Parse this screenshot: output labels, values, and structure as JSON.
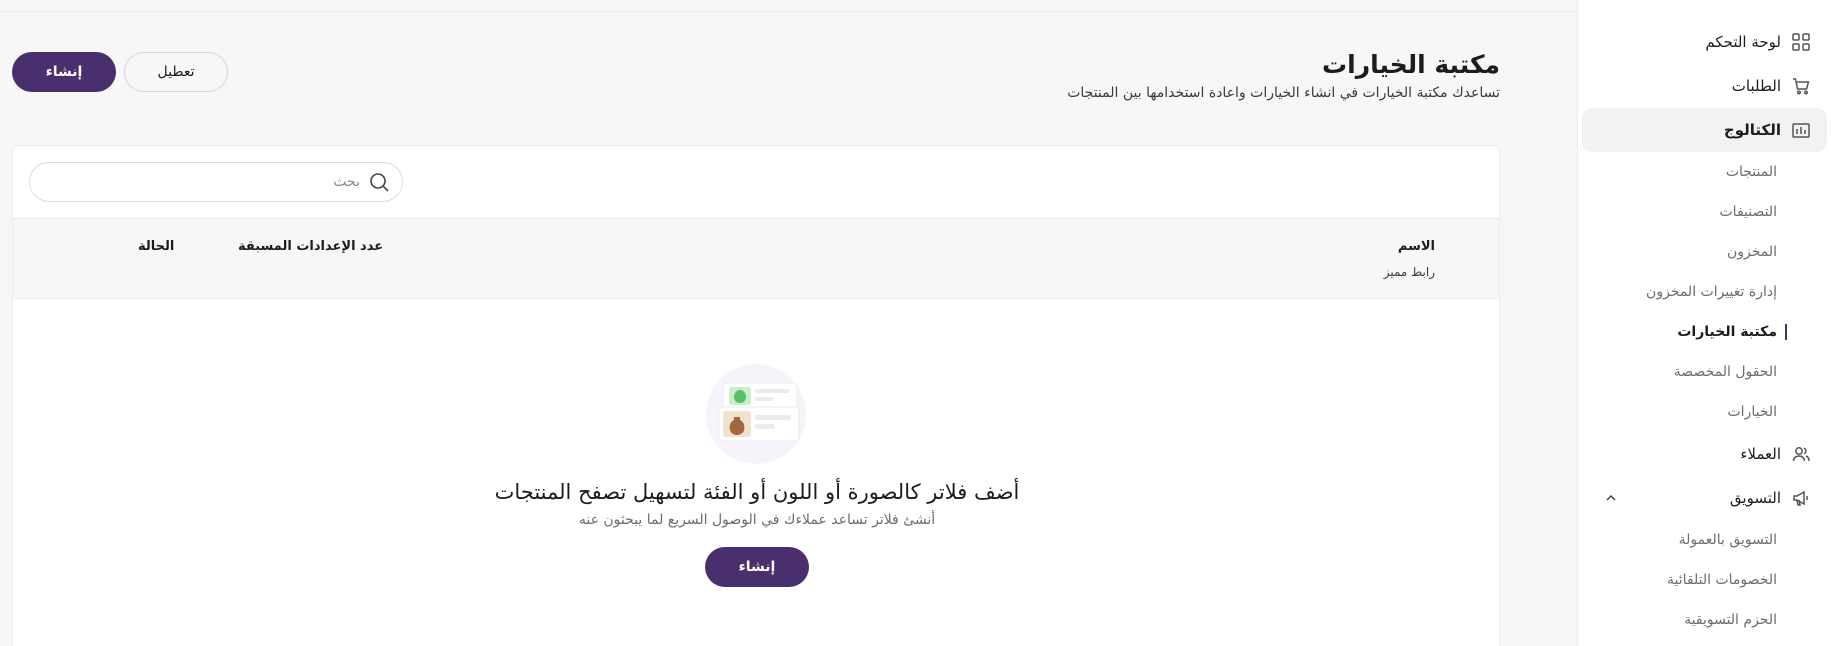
{
  "sidebar": {
    "items": [
      {
        "label": "لوحة التحكم",
        "icon": "dashboard-icon"
      },
      {
        "label": "الطلبات",
        "icon": "cart-icon"
      },
      {
        "label": "الكتالوج",
        "icon": "catalog-icon"
      },
      {
        "label": "العملاء",
        "icon": "users-icon"
      },
      {
        "label": "التسويق",
        "icon": "megaphone-icon"
      }
    ],
    "catalog_subitems": [
      "المنتجات",
      "التصنيفات",
      "المخزون",
      "إدارة تغييرات المخزون",
      "مكتبة الخيارات",
      "الحقول المخصصة",
      "الخيارات"
    ],
    "marketing_subitems": [
      "التسويق بالعمولة",
      "الخصومات التلقائية",
      "الحزم التسويقية"
    ],
    "active_item": "الكتالوج",
    "current_subitem": "مكتبة الخيارات"
  },
  "header": {
    "title": "مكتبة الخيارات",
    "subtitle": "تساعدك مكتبة الخيارات في انشاء الخيارات واعادة استخدامها بين المنتجات",
    "create_label": "إنشاء",
    "disable_label": "تعطيل"
  },
  "search": {
    "placeholder": "بحث",
    "value": ""
  },
  "table": {
    "columns": {
      "name": "الاسم",
      "name_sub": "رابط مميز",
      "presets": "عدد الإعدادات المسبقة",
      "status": "الحالة"
    }
  },
  "empty_state": {
    "title": "أضف فلاتر كالصورة أو اللون أو الفئة لتسهيل تصفح المنتجات",
    "subtitle": "أنشئ فلاتر تساعد عملاءك في الوصول السريع لما يبحثون عنه",
    "button_label": "إنشاء"
  },
  "colors": {
    "brand": "#4a2f6e",
    "background": "#f7f7f8",
    "card": "#ffffff"
  }
}
